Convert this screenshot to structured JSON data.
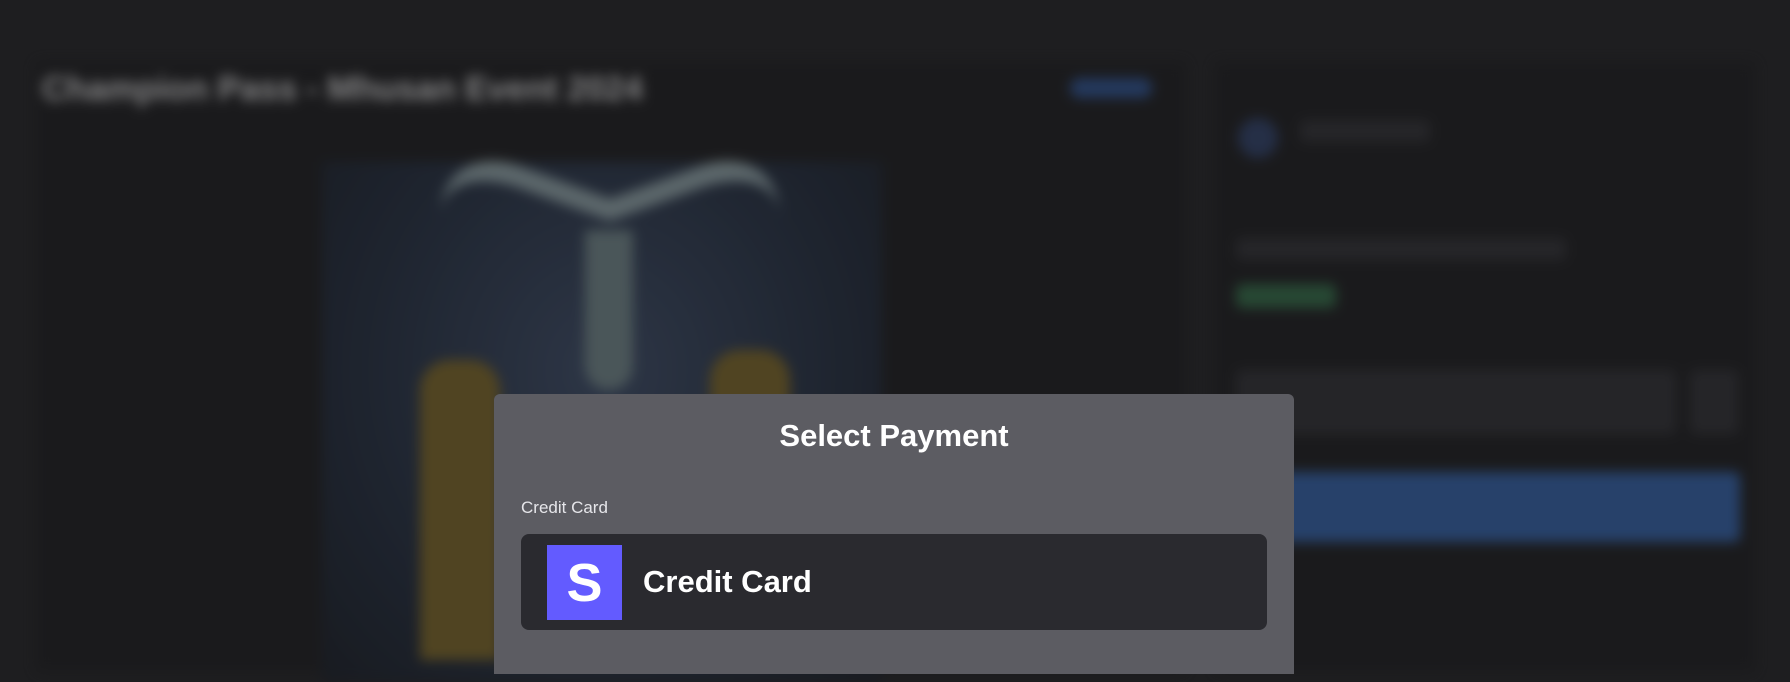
{
  "background": {
    "product_title": "Champion Pass - Mhusan Event 2024"
  },
  "modal": {
    "title": "Select Payment",
    "section_label": "Credit Card",
    "options": [
      {
        "label": "Credit Card",
        "icon": "stripe-s-icon",
        "icon_glyph": "S",
        "brand_color": "#635bff"
      }
    ]
  },
  "colors": {
    "modal_bg": "#5c5c62",
    "option_bg": "#2a2a2f",
    "stripe": "#635bff"
  }
}
